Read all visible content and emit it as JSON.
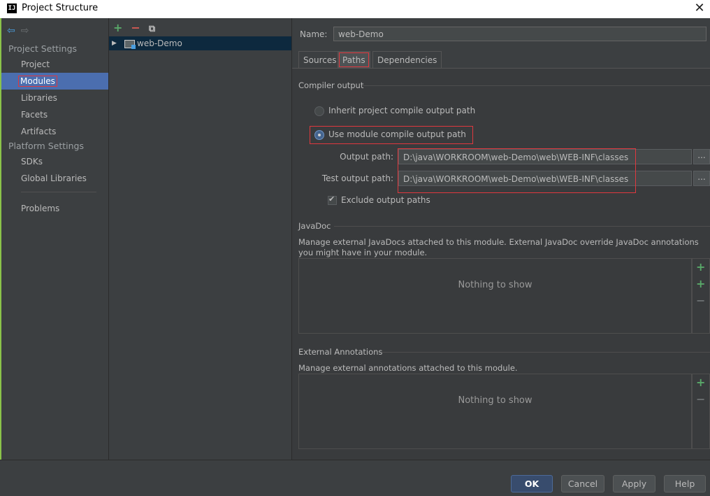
{
  "window": {
    "title": "Project Structure"
  },
  "sidebar": {
    "project_settings_header": "Project Settings",
    "platform_settings_header": "Platform Settings",
    "items": [
      {
        "label": "Project"
      },
      {
        "label": "Modules"
      },
      {
        "label": "Libraries"
      },
      {
        "label": "Facets"
      },
      {
        "label": "Artifacts"
      },
      {
        "label": "SDKs"
      },
      {
        "label": "Global Libraries"
      },
      {
        "label": "Problems"
      }
    ]
  },
  "tree": {
    "items": [
      {
        "label": "web-Demo"
      }
    ]
  },
  "module": {
    "name_label": "Name:",
    "name_value": "web-Demo",
    "tabs": [
      {
        "label": "Sources"
      },
      {
        "label": "Paths"
      },
      {
        "label": "Dependencies"
      }
    ],
    "active_tab": "Paths"
  },
  "compiler_output": {
    "title": "Compiler output",
    "inherit_label": "Inherit project compile output path",
    "use_module_label": "Use module compile output path",
    "selected": "use_module",
    "output_path_label": "Output path:",
    "output_path_value": "D:\\java\\WORKROOM\\web-Demo\\web\\WEB-INF\\classes",
    "test_output_path_label": "Test output path:",
    "test_output_path_value": "D:\\java\\WORKROOM\\web-Demo\\web\\WEB-INF\\classes",
    "browse_label": "...",
    "exclude_label": "Exclude output paths",
    "exclude_checked": true
  },
  "javadoc": {
    "title": "JavaDoc",
    "description": "Manage external JavaDocs attached to this module. External JavaDoc override JavaDoc annotations you might have in your module.",
    "empty_text": "Nothing to show"
  },
  "external_annotations": {
    "title": "External Annotations",
    "description": "Manage external annotations attached to this module.",
    "empty_text": "Nothing to show"
  },
  "buttons": {
    "ok": "OK",
    "cancel": "Cancel",
    "apply": "Apply",
    "help": "Help"
  },
  "colors": {
    "selection": "#4b6eaf",
    "highlight_box": "#e0383e",
    "add": "#59a869",
    "remove": "#d35a54"
  }
}
